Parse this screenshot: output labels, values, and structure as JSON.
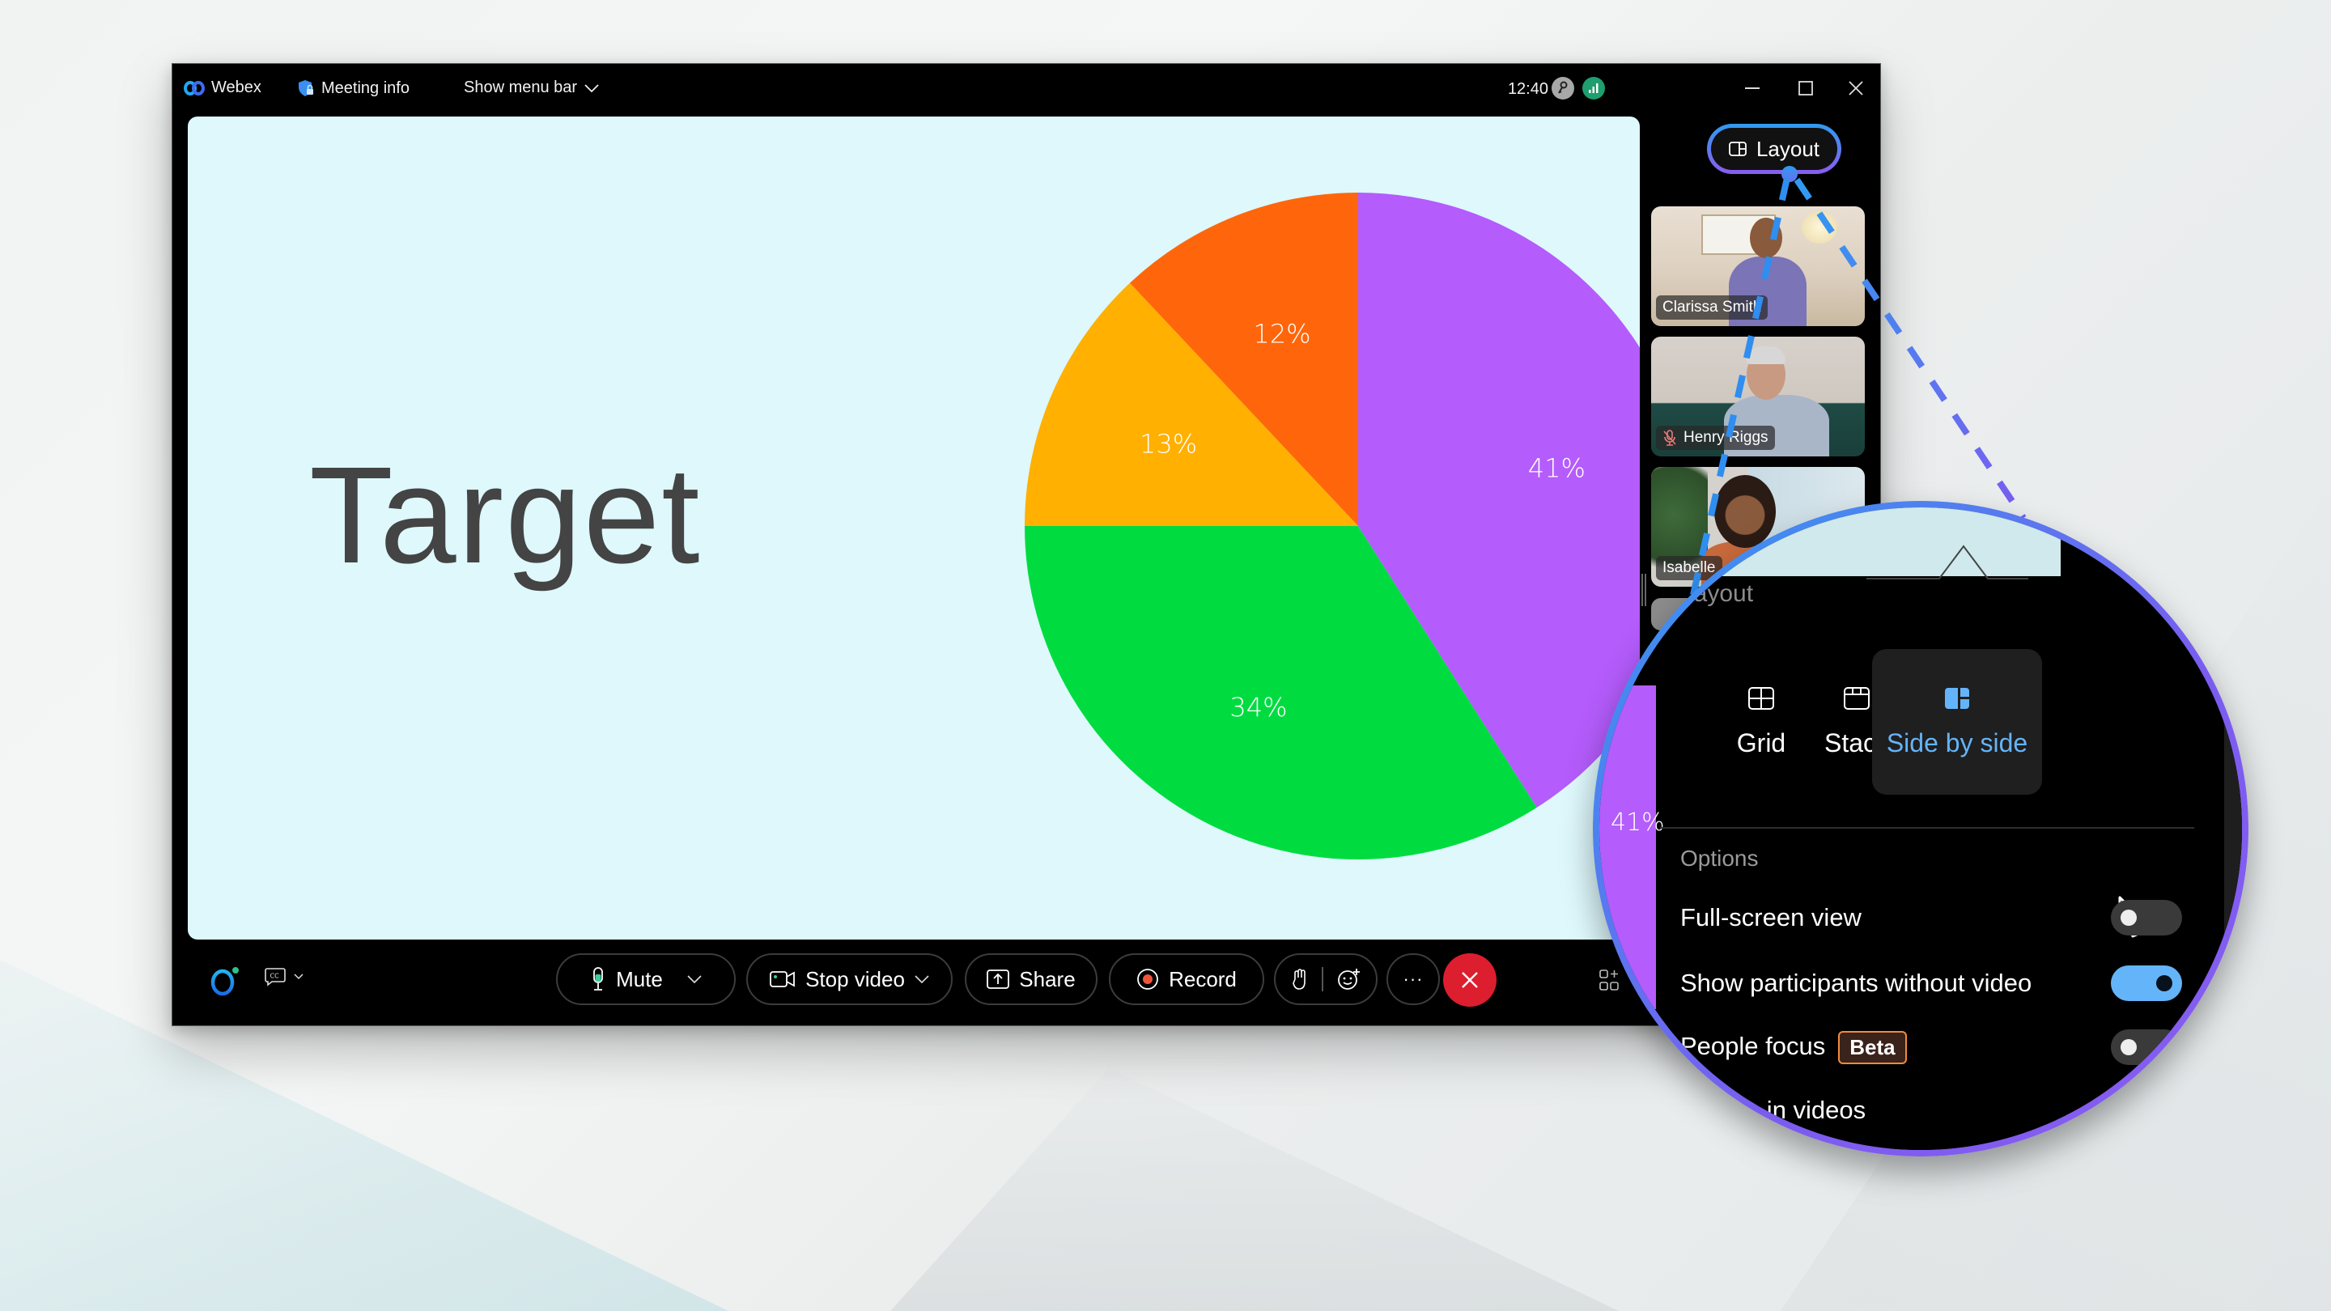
{
  "titlebar": {
    "app_name": "Webex",
    "meeting_info": "Meeting info",
    "show_menu_bar": "Show menu bar",
    "time": "12:40"
  },
  "stage": {
    "title": "Target"
  },
  "chart_data": {
    "type": "pie",
    "title": "Target",
    "start_angle_deg": 0,
    "direction": "clockwise",
    "slices": [
      {
        "label": "41%",
        "value": 41,
        "color": "#B45CFC"
      },
      {
        "label": "34%",
        "value": 34,
        "color": "#00DC40"
      },
      {
        "label": "13%",
        "value": 13,
        "color": "#FFB000"
      },
      {
        "label": "12%",
        "value": 12,
        "color": "#FF660B"
      }
    ]
  },
  "layout_button": {
    "label": "Layout"
  },
  "participants": [
    {
      "name": "Clarissa Smith",
      "muted": false
    },
    {
      "name": "Henry Riggs",
      "muted": true
    },
    {
      "name": "Isabelle",
      "muted": false
    }
  ],
  "toolbar": {
    "mute_label": "Mute",
    "stop_video_label": "Stop video",
    "share_label": "Share",
    "record_label": "Record",
    "more_label": "···"
  },
  "layout_popover": {
    "header": "Layout",
    "options": [
      {
        "label": "Grid",
        "selected": false
      },
      {
        "label": "Stack",
        "selected": false
      },
      {
        "label": "Side by side",
        "selected": true
      }
    ],
    "options_header": "Options",
    "settings": [
      {
        "label": "Full-screen view",
        "enabled": false
      },
      {
        "label": "Show participants without video",
        "enabled": true
      },
      {
        "label": "People focus",
        "badge": "Beta",
        "enabled": false
      }
    ],
    "names_in_videos": "Names in videos",
    "magnified_slice_label": "41%"
  },
  "colors": {
    "accent_blue": "#64B4FA",
    "end_call_red": "#DC1E2E",
    "stage_background": "#DEF8FC",
    "beta_border": "#F28A3C"
  }
}
